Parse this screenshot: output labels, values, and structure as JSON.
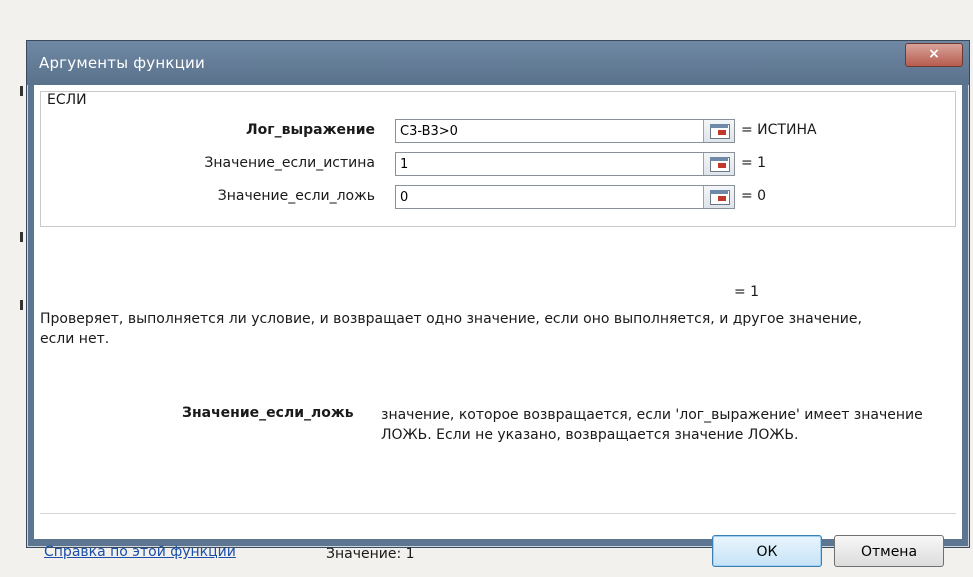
{
  "dialog": {
    "title": "Аргументы функции",
    "close_label": "×"
  },
  "function": {
    "name": "ЕСЛИ",
    "args": [
      {
        "label": "Лог_выражение",
        "value": "C3-B3>0",
        "result": "= ИСТИНА",
        "bold": true
      },
      {
        "label": "Значение_если_истина",
        "value": "1",
        "result": "= 1",
        "bold": false
      },
      {
        "label": "Значение_если_ложь",
        "value": "0",
        "result": "= 0",
        "bold": false
      }
    ],
    "formula_result": "= 1",
    "description": "Проверяет, выполняется ли условие, и возвращает одно значение, если оно выполняется, и другое значение, если нет.",
    "param_name": "Значение_если_ложь",
    "param_description": "значение, которое возвращается, если 'лог_выражение' имеет значение ЛОЖЬ. Если не указано, возвращается значение ЛОЖЬ."
  },
  "footer": {
    "help_link": "Справка по этой функции",
    "value_text": "Значение: 1",
    "ok_label": "ОК",
    "cancel_label": "Отмена"
  },
  "colors": {
    "titlebar": "#5c7590",
    "link": "#1b4fa8",
    "close": "#b75c4e"
  }
}
